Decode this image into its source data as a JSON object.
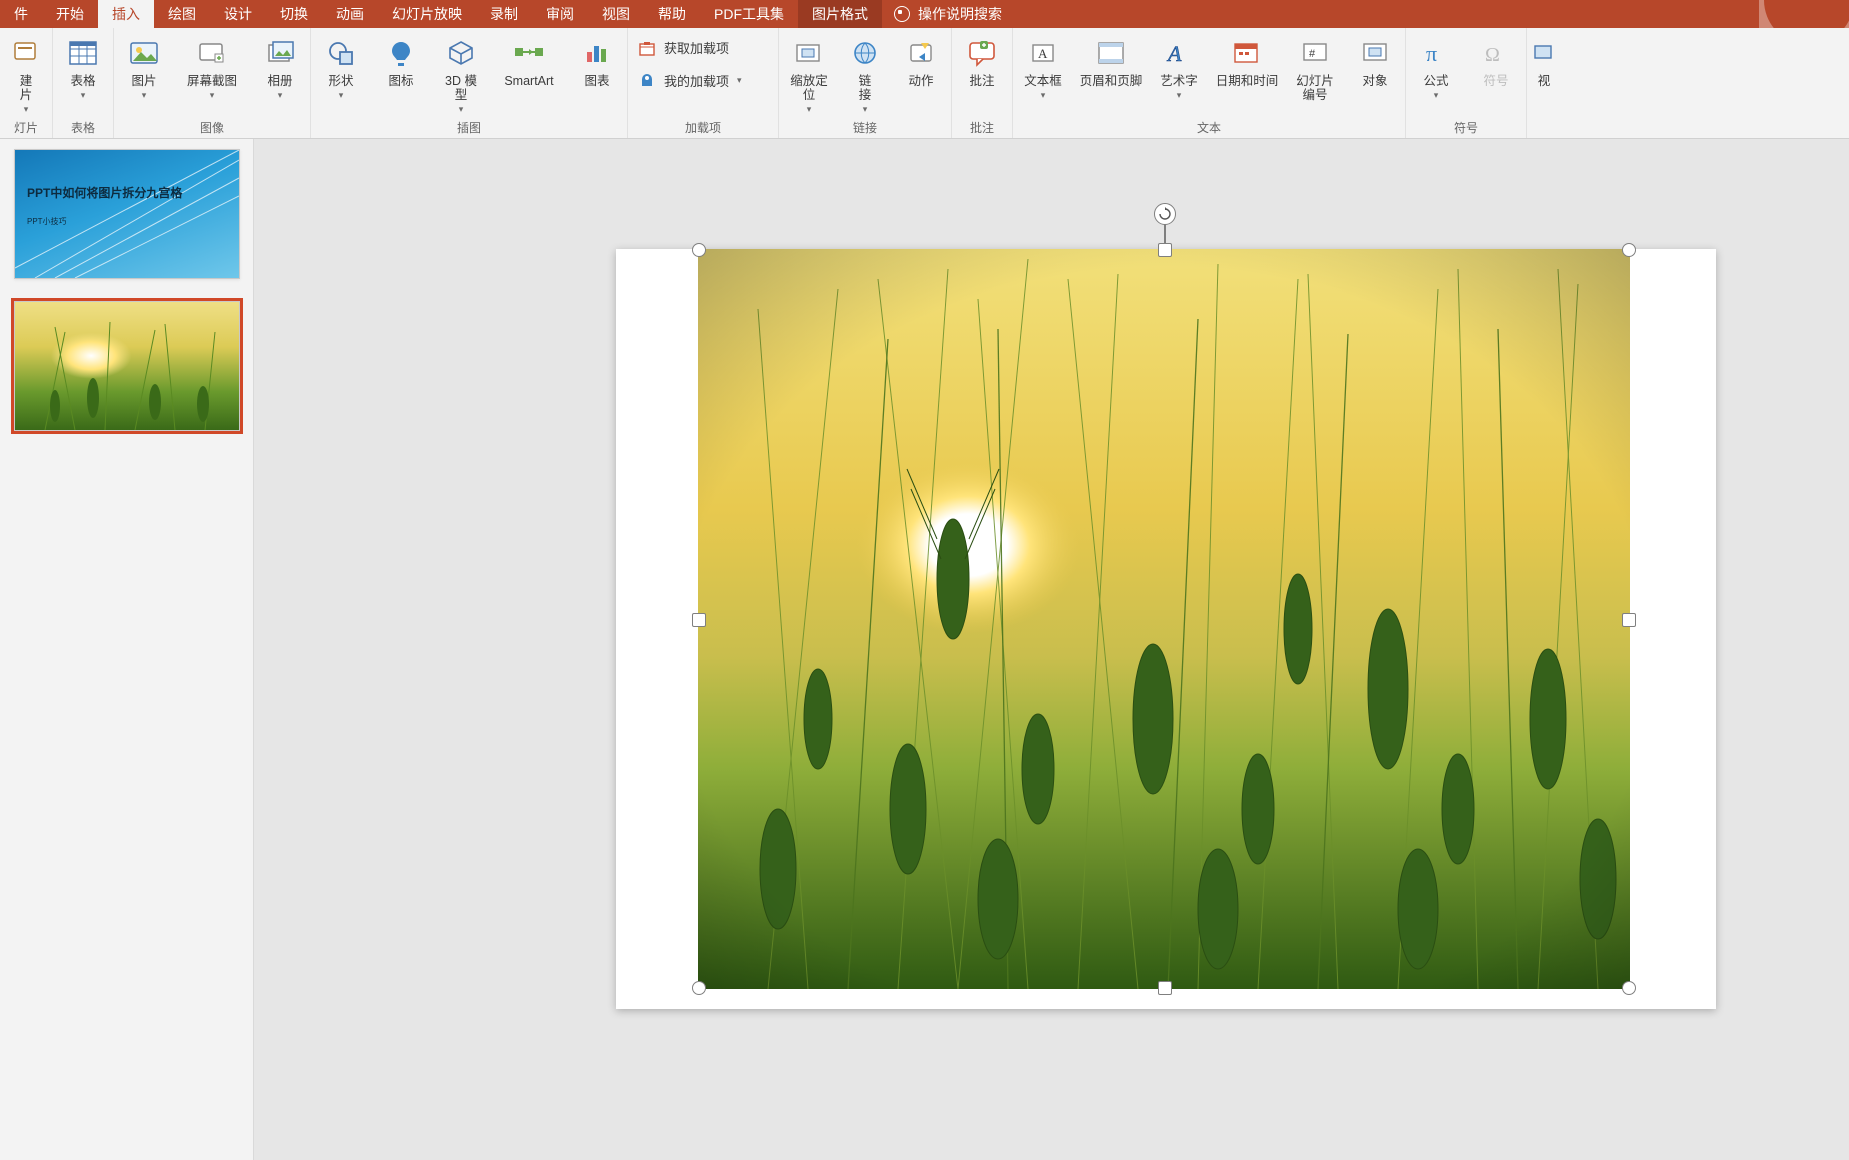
{
  "tabs": {
    "file_stub": "件",
    "home": "开始",
    "insert": "插入",
    "draw": "绘图",
    "design": "设计",
    "transitions": "切换",
    "animations": "动画",
    "slideshow": "幻灯片放映",
    "record": "录制",
    "review": "审阅",
    "view": "视图",
    "help": "帮助",
    "pdf": "PDF工具集",
    "picture_format": "图片格式",
    "tellme": "操作说明搜索"
  },
  "ribbon": {
    "slides": {
      "new_slide_l1": "建",
      "new_slide_l2": "片",
      "group": "灯片"
    },
    "tables": {
      "table": "表格",
      "group": "表格"
    },
    "images": {
      "pictures": "图片",
      "screenshot": "屏幕截图",
      "album": "相册",
      "group": "图像"
    },
    "illus": {
      "shapes": "形状",
      "icons": "图标",
      "models_l1": "3D 模",
      "models_l2": "型",
      "smartart": "SmartArt",
      "chart": "图表",
      "group": "插图"
    },
    "addins": {
      "get": "获取加载项",
      "my": "我的加载项",
      "group": "加载项"
    },
    "links": {
      "zoom_l1": "缩放定",
      "zoom_l2": "位",
      "link_l1": "链",
      "link_l2": "接",
      "action": "动作",
      "group": "链接"
    },
    "comments": {
      "comment": "批注",
      "group": "批注"
    },
    "text": {
      "textbox": "文本框",
      "headerfooter": "页眉和页脚",
      "wordart": "艺术字",
      "datetime": "日期和时间",
      "slidenum_l1": "幻灯片",
      "slidenum_l2": "编号",
      "object": "对象",
      "group": "文本"
    },
    "symbols": {
      "equation": "公式",
      "symbol": "符号",
      "group": "符号"
    },
    "media": {
      "video_stub": "视",
      "group": ""
    }
  },
  "thumbs": {
    "slide1_title": "PPT中如何将图片拆分九宫格",
    "slide1_sub": "PPT小技巧"
  },
  "image": {
    "alt": "wheat field at sunset",
    "colors": {
      "sky_top": "#f2e07a",
      "sky_mid": "#e8c94f",
      "sun": "#ffffff",
      "halo": "#ffd24a",
      "grass_light": "#7fae33",
      "grass_dark": "#2f5a12"
    }
  }
}
